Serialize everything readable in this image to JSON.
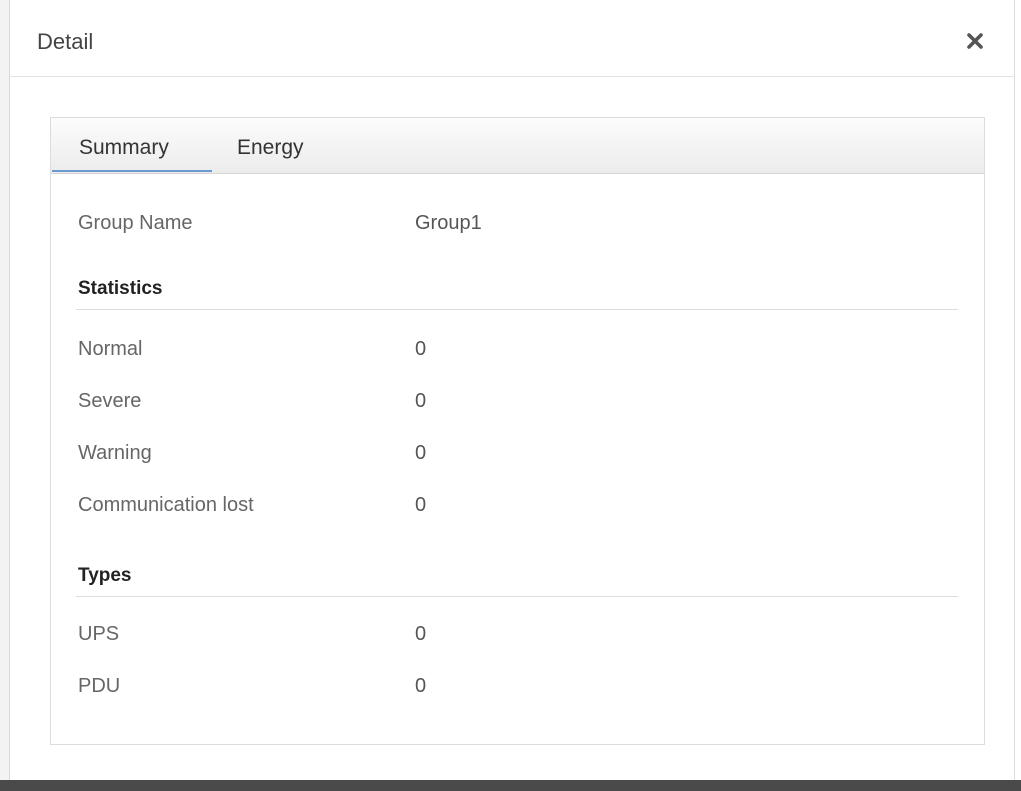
{
  "dialog": {
    "title": "Detail",
    "close_icon": "close-x-icon"
  },
  "tabs": [
    {
      "label": "Summary",
      "active": true
    },
    {
      "label": "Energy",
      "active": false
    }
  ],
  "summary": {
    "group_name": {
      "label": "Group Name",
      "value": "Group1"
    },
    "statistics": {
      "title": "Statistics",
      "rows": [
        {
          "label": "Normal",
          "value": "0"
        },
        {
          "label": "Severe",
          "value": "0"
        },
        {
          "label": "Warning",
          "value": "0"
        },
        {
          "label": "Communication lost",
          "value": "0"
        }
      ]
    },
    "types": {
      "title": "Types",
      "rows": [
        {
          "label": "UPS",
          "value": "0"
        },
        {
          "label": "PDU",
          "value": "0"
        }
      ]
    }
  },
  "colors": {
    "tab_underline": "#6a9ad0",
    "title_text": "#444444"
  }
}
